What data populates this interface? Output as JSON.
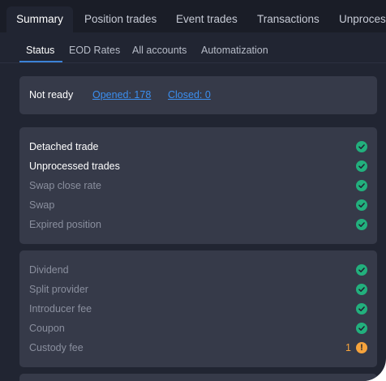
{
  "tabs": [
    {
      "label": "Summary",
      "active": true
    },
    {
      "label": "Position trades",
      "active": false
    },
    {
      "label": "Event trades",
      "active": false
    },
    {
      "label": "Transactions",
      "active": false
    },
    {
      "label": "Unprocess",
      "active": false
    }
  ],
  "subtabs": [
    {
      "label": "Status",
      "active": true
    },
    {
      "label": "EOD Rates",
      "active": false
    },
    {
      "label": "All accounts",
      "active": false
    },
    {
      "label": "Automatization",
      "active": false
    }
  ],
  "status": {
    "state": "Not ready",
    "opened_link": "Opened: 178",
    "closed_link": "Closed: 0"
  },
  "group1": [
    {
      "label": "Detached trade",
      "state": "ok",
      "icon": "check-icon"
    },
    {
      "label": "Unprocessed trades",
      "state": "ok",
      "icon": "check-icon"
    },
    {
      "label": "Swap close rate",
      "state": "ok",
      "icon": "check-icon"
    },
    {
      "label": "Swap",
      "state": "ok",
      "icon": "check-icon"
    },
    {
      "label": "Expired position",
      "state": "ok",
      "icon": "check-icon"
    }
  ],
  "group2": [
    {
      "label": "Dividend",
      "state": "ok",
      "icon": "check-icon"
    },
    {
      "label": "Split provider",
      "state": "ok",
      "icon": "check-icon"
    },
    {
      "label": "Introducer fee",
      "state": "ok",
      "icon": "check-icon"
    },
    {
      "label": "Coupon",
      "state": "ok",
      "icon": "check-icon"
    },
    {
      "label": "Custody fee",
      "state": "warning",
      "icon": "warning-icon",
      "count": "1",
      "glyph": "!"
    }
  ],
  "colors": {
    "ok": "#22b07d",
    "warning": "#f6a33c",
    "link": "#3b8ff0",
    "accent": "#3b82d6"
  }
}
